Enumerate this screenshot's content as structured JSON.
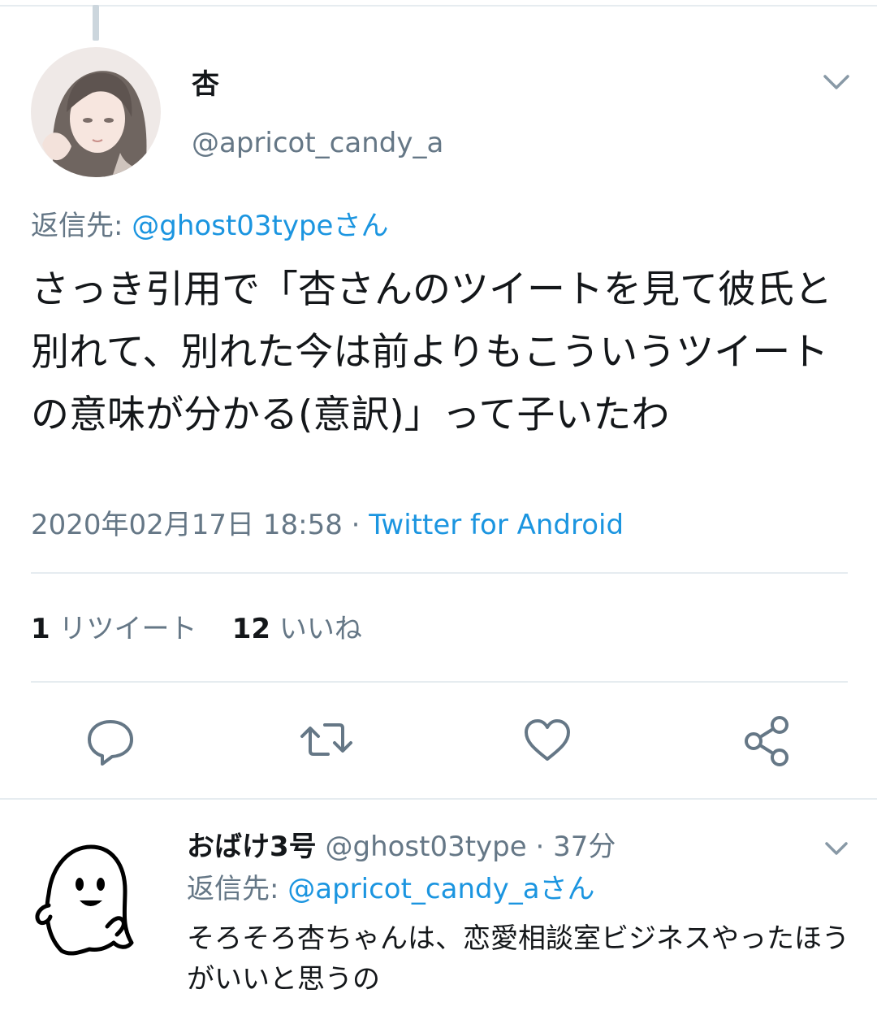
{
  "tweet": {
    "display_name": "杏",
    "handle": "@apricot_candy_a",
    "reply_to_label": "返信先: ",
    "reply_to_mention": "@ghost03typeさん",
    "text": "さっき引用で「杏さんのツイートを見て彼氏と別れて、別れた今は前よりもこういうツイートの意味が分かる(意訳)」って子いたわ",
    "timestamp": "2020年02月17日 18:58 · ",
    "source": "Twitter for Android",
    "retweet_count": "1",
    "retweet_label": "リツイート",
    "like_count": "12",
    "like_label": "いいね"
  },
  "reply": {
    "display_name": "おばけ3号",
    "handle": "@ghost03type",
    "time": "· 37分",
    "reply_to_label": "返信先: ",
    "reply_to_mention": "@apricot_candy_aさん",
    "text": "そろそろ杏ちゃんは、恋愛相談室ビジネスやったほうがいいと思うの"
  },
  "colors": {
    "link": "#1b95e0",
    "secondary_text": "#657786",
    "primary_text": "#14171a",
    "divider": "#e6ecf0"
  },
  "icons": [
    "chevron-down-icon",
    "reply-icon",
    "retweet-icon",
    "like-icon",
    "share-icon"
  ]
}
